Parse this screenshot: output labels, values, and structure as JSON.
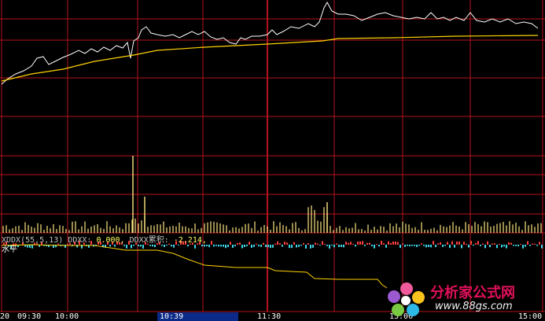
{
  "indicator": {
    "name": "XDDX(55,5,13)",
    "ddx_label": "DDXX:",
    "ddx_value": "0.000,",
    "cum_label": "DDXX累积:",
    "cum_value": "-2.214,"
  },
  "sub_label": "水平",
  "time_axis": [
    "20",
    "09:30",
    "10:00",
    "10:39",
    "11:30",
    "13:00",
    "15:00"
  ],
  "logo": {
    "name": "分析家公式网",
    "site": "www.88gs.com"
  },
  "colors": {
    "grid": "#b4141e",
    "price": "#ffffff",
    "avg": "#ffd200",
    "volume": "#ffe680",
    "flow_up": "#ff4040",
    "flow_down": "#40d8e8",
    "accent": "#e0105a"
  }
}
